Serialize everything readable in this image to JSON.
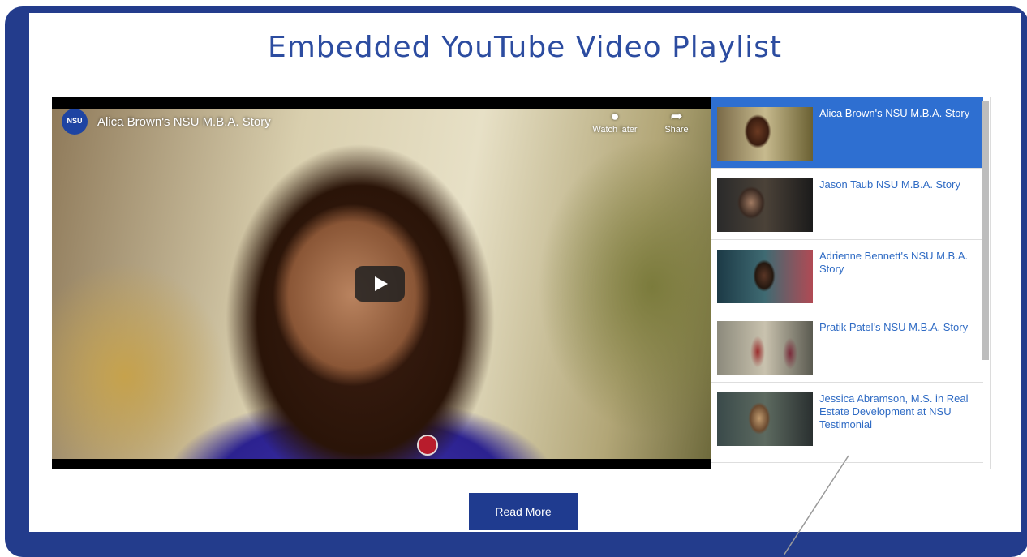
{
  "page": {
    "title": "Embedded YouTube Video Playlist"
  },
  "player": {
    "channel_logo_text": "NSU",
    "video_title": "Alica Brown's NSU M.B.A. Story",
    "watch_later_label": "Watch later",
    "share_label": "Share",
    "icons": {
      "watch_later": "clock-icon",
      "share": "share-arrow-icon",
      "play": "play-icon"
    }
  },
  "playlist": {
    "items": [
      {
        "title": "Alica Brown's NSU M.B.A. Story",
        "active": true
      },
      {
        "title": "Jason Taub NSU M.B.A. Story",
        "active": false
      },
      {
        "title": "Adrienne Bennett's NSU M.B.A. Story",
        "active": false
      },
      {
        "title": "Pratik Patel's NSU M.B.A. Story",
        "active": false
      },
      {
        "title": "Jessica Abramson, M.S. in Real Estate Development at NSU Testimonial",
        "active": false
      }
    ]
  },
  "actions": {
    "read_more_label": "Read More"
  },
  "colors": {
    "frame": "#233c8c",
    "title": "#2c4ca0",
    "active_item": "#2e6fd1",
    "button": "#1f3b8f"
  }
}
